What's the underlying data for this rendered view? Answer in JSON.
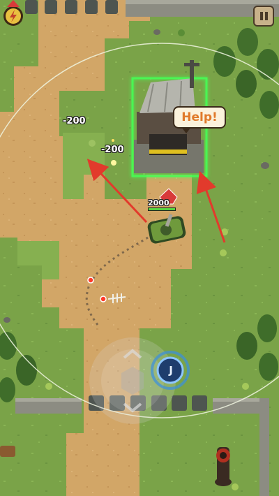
{
  "hud": {
    "pause_icon": "pause-icon",
    "alert_icon": "lightning-badge-icon",
    "accent_color": "#e8c040"
  },
  "floating_text": {
    "damage_1": "-200",
    "damage_2": "-200"
  },
  "npc": {
    "help_text": "Help!"
  },
  "player": {
    "hp_label": "2000",
    "hp_fraction": 1.0
  },
  "controls": {
    "skill_button_label": "J",
    "joystick_icon": "joystick-icon"
  },
  "colors": {
    "grass": "#7aa348",
    "dirt": "#d2a667",
    "highlight_glow": "#44ff55",
    "arrow": "#e23a2c"
  }
}
